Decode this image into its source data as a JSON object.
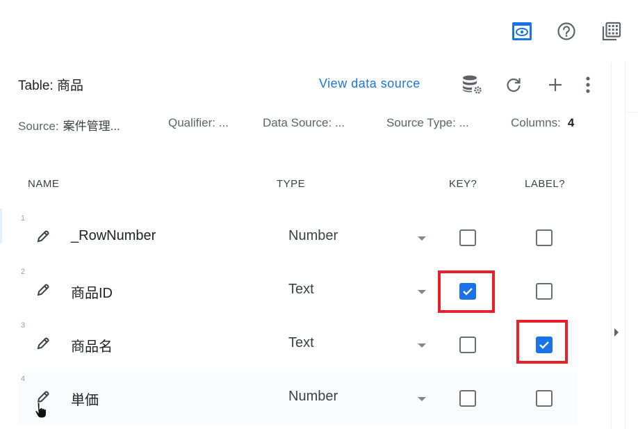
{
  "top_toolbar": {
    "icons": [
      {
        "name": "preview-icon",
        "active": true,
        "color": "#1a73e8"
      },
      {
        "name": "help-icon"
      },
      {
        "name": "gallery-icon"
      }
    ]
  },
  "header": {
    "title": "Table: 商品",
    "view_data_source": "View data source",
    "actions": [
      "data-source-settings",
      "refresh",
      "add",
      "more"
    ]
  },
  "meta": {
    "source_label": "Source:",
    "source_value": "案件管理...",
    "qualifier": "Qualifier: ...",
    "data_source": "Data Source: ...",
    "source_type": "Source Type: ...",
    "columns_label": "Columns:",
    "columns_value": "4"
  },
  "columns_header": {
    "name": "NAME",
    "type": "TYPE",
    "key": "KEY?",
    "label": "LABEL?"
  },
  "rows": [
    {
      "num": "1",
      "name": "_RowNumber",
      "type": "Number",
      "key": false,
      "label": false
    },
    {
      "num": "2",
      "name": "商品ID",
      "type": "Text",
      "key": true,
      "label": false
    },
    {
      "num": "3",
      "name": "商品名",
      "type": "Text",
      "key": false,
      "label": true
    },
    {
      "num": "4",
      "name": "単価",
      "type": "Number",
      "key": false,
      "label": false
    }
  ],
  "colors": {
    "accent": "#1a73e8",
    "highlight": "#e8202a"
  }
}
